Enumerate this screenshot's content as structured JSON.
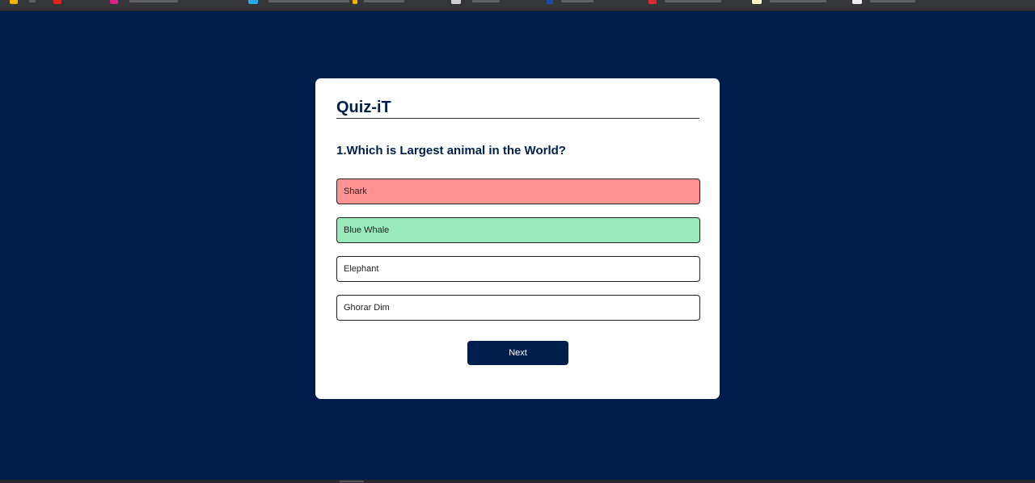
{
  "app": {
    "title": "Quiz-iT"
  },
  "quiz": {
    "question": "1.Which is Largest animal in the World?",
    "answers": [
      {
        "label": "Shark",
        "state": "incorrect"
      },
      {
        "label": "Blue Whale",
        "state": "correct"
      },
      {
        "label": "Elephant",
        "state": "neutral"
      },
      {
        "label": "Ghorar Dim",
        "state": "neutral"
      }
    ],
    "next_label": "Next"
  },
  "colors": {
    "background": "#001e4d",
    "card": "#ffffff",
    "incorrect": "#ff9393",
    "correct": "#9aeabc",
    "accent": "#001e4d"
  }
}
